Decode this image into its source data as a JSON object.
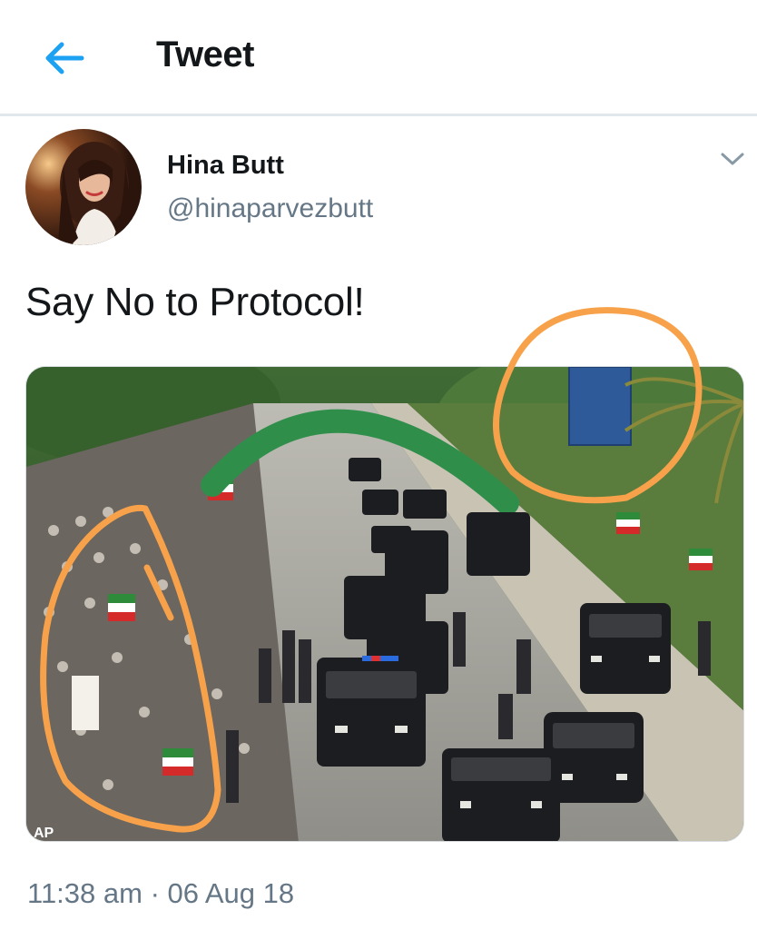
{
  "header": {
    "title": "Tweet",
    "back_icon": "arrow-left-icon",
    "accent": "#1da1f2"
  },
  "tweet": {
    "author_name": "Hina Butt",
    "author_handle": "@hinaparvezbutt",
    "text": "Say No to Protocol!",
    "timestamp": "11:38 am · 06 Aug 18",
    "menu_icon": "chevron-down-icon"
  },
  "media": {
    "kind": "photo",
    "watermark": "AP",
    "annotation_color": "#f7a24b"
  }
}
